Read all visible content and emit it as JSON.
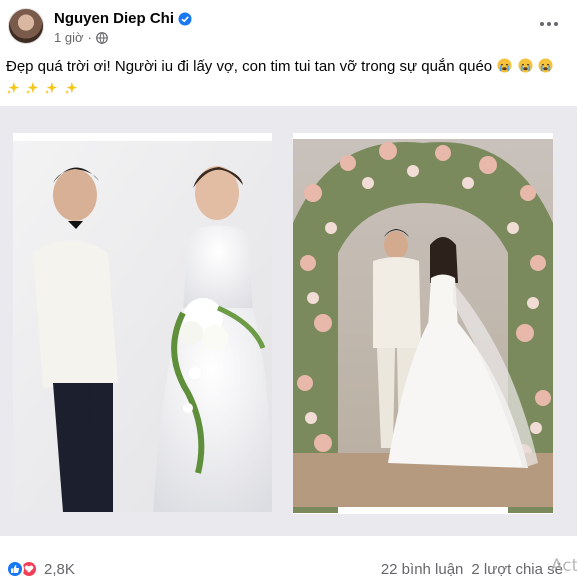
{
  "post": {
    "author_name": "Nguyen Diep Chi",
    "timestamp": "1 giờ",
    "caption_text": "Đẹp quá trời ơi! Người iu đi lấy vợ, con tim tui tan vỡ trong sự quắn quéo",
    "caption_emoji": "crying-face-emoji x3",
    "caption_sparkles": "sparkles-emoji x4"
  },
  "footer": {
    "reaction_count": "2,8K",
    "comments": "22 bình luận",
    "shares": "2 lượt chia sẻ",
    "watermark": "Acti"
  },
  "colors": {
    "like_blue": "#1877f2",
    "love_red": "#f33e58",
    "secondary_text": "#65676b",
    "media_background": "#e9e9ee"
  }
}
